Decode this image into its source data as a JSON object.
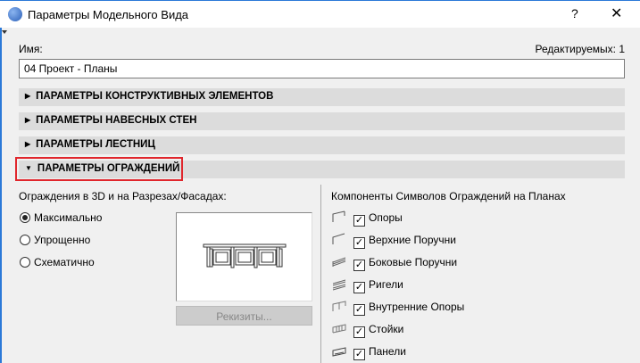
{
  "window": {
    "title": "Параметры Модельного Вида",
    "help": "?",
    "close": "✕"
  },
  "name": {
    "label": "Имя:",
    "value": "04 Проект - Планы",
    "editable_count": "Редактируемых: 1"
  },
  "sections": [
    {
      "label": "ПАРАМЕТРЫ КОНСТРУКТИВНЫХ ЭЛЕМЕНТОВ",
      "expanded": false
    },
    {
      "label": "ПАРАМЕТРЫ НАВЕСНЫХ СТЕН",
      "expanded": false
    },
    {
      "label": "ПАРАМЕТРЫ ЛЕСТНИЦ",
      "expanded": false
    },
    {
      "label": "ПАРАМЕТРЫ ОГРАЖДЕНИЙ",
      "expanded": true
    }
  ],
  "railings": {
    "left_title": "Ограждения в 3D и на Разрезах/Фасадах:",
    "options": [
      {
        "label": "Максимально",
        "selected": true
      },
      {
        "label": "Упрощенно",
        "selected": false
      },
      {
        "label": "Схематично",
        "selected": false
      }
    ],
    "button": "Рекизиты...",
    "right_title": "Компоненты Символов Ограждений на Планах",
    "components": [
      {
        "label": "Опоры",
        "checked": true,
        "icon": "post-icon"
      },
      {
        "label": "Верхние Поручни",
        "checked": true,
        "icon": "top-rail-icon"
      },
      {
        "label": "Боковые Поручни",
        "checked": true,
        "icon": "handrail-icon"
      },
      {
        "label": "Ригели",
        "checked": true,
        "icon": "rail-icon"
      },
      {
        "label": "Внутренние Опоры",
        "checked": true,
        "icon": "inner-post-icon"
      },
      {
        "label": "Стойки",
        "checked": true,
        "icon": "baluster-icon"
      },
      {
        "label": "Панели",
        "checked": true,
        "icon": "panel-icon"
      }
    ]
  }
}
